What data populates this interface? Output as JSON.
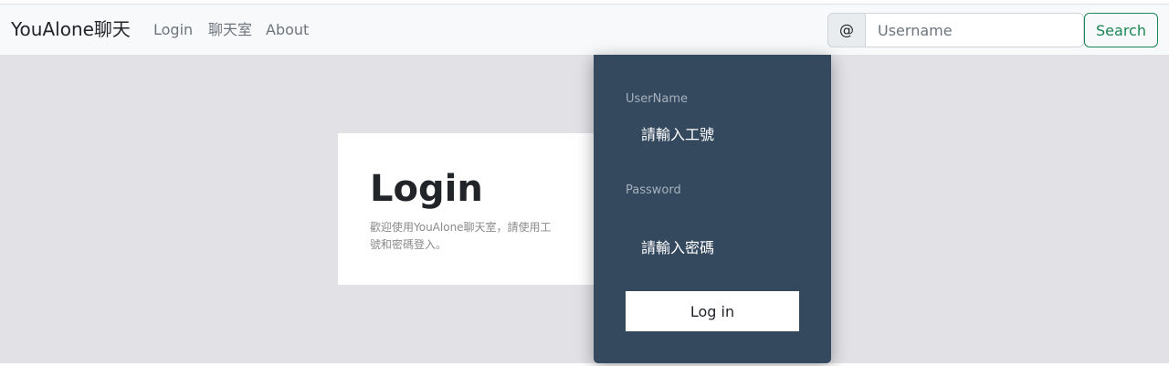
{
  "navbar": {
    "brand": "YouAlone聊天",
    "links": [
      "Login",
      "聊天室",
      "About"
    ],
    "at_symbol": "@",
    "username_placeholder": "Username",
    "search_label": "Search"
  },
  "login_card": {
    "title": "Login",
    "description": "歡迎使用YouAlone聊天室，請使用工號和密碼登入。"
  },
  "login_form": {
    "username_label": "UserName",
    "username_placeholder": "請輸入工號",
    "password_label": "Password",
    "password_placeholder": "請輸入密碼",
    "submit_label": "Log in"
  },
  "colors": {
    "panel": "#34485e",
    "page_background": "#e2e1e6",
    "search_accent": "#198754"
  }
}
